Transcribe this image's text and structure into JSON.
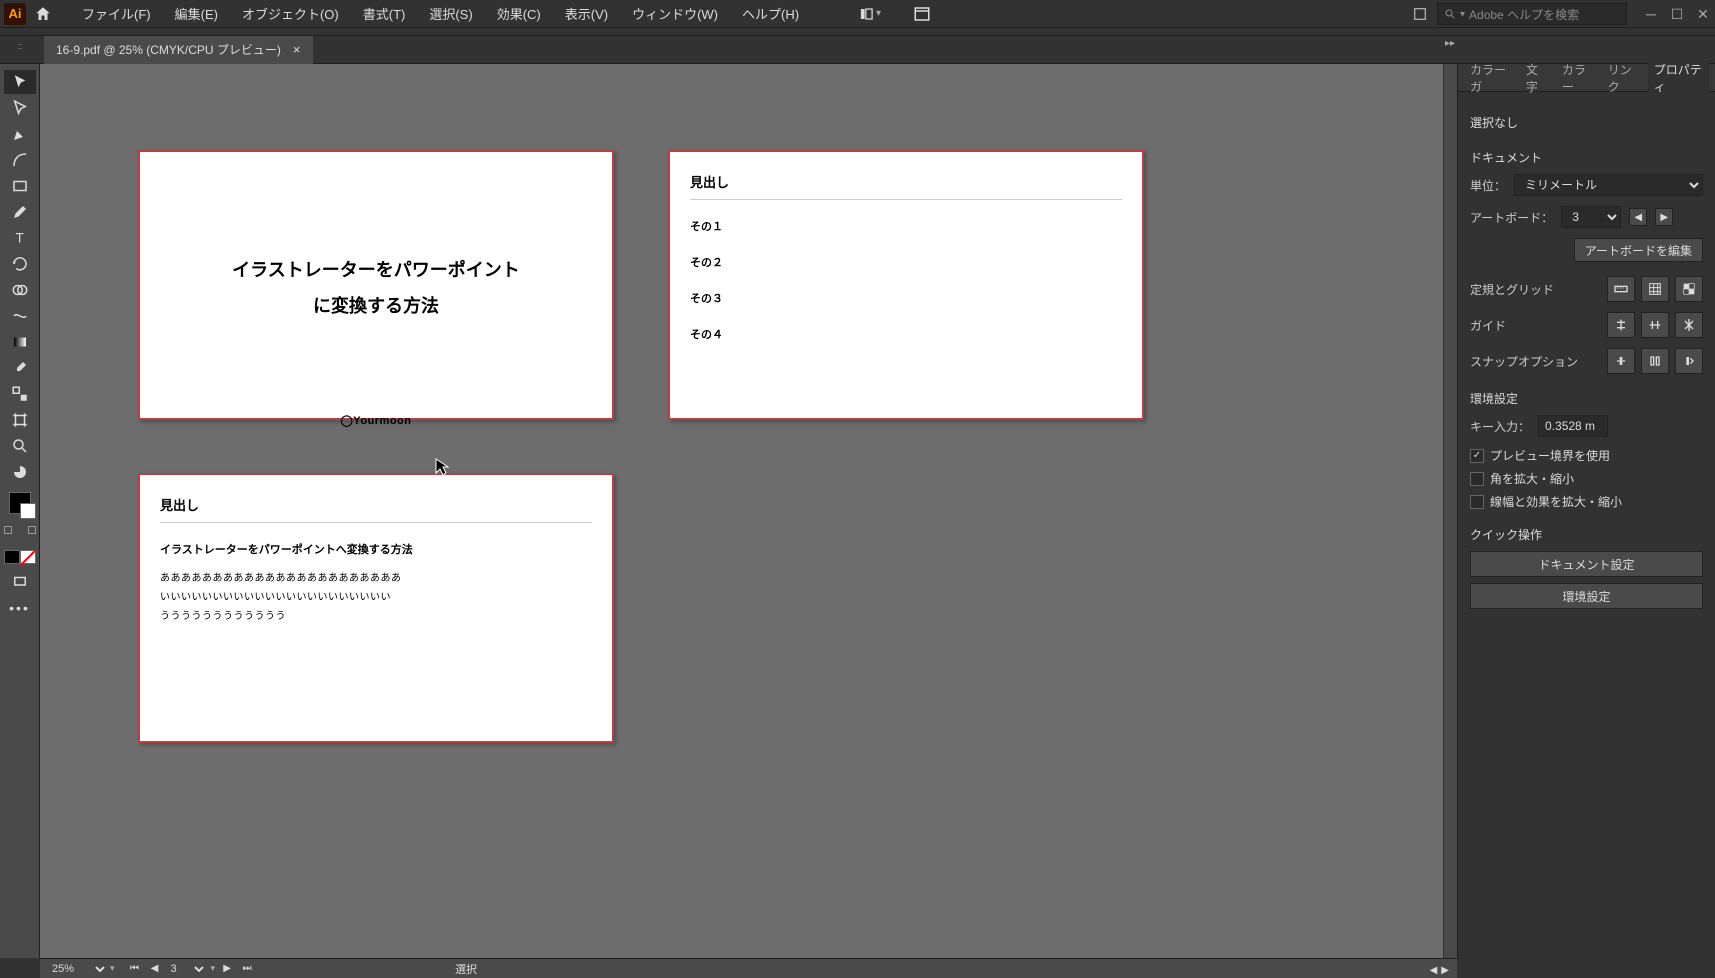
{
  "menu": {
    "items": [
      "ファイル(F)",
      "編集(E)",
      "オブジェクト(O)",
      "書式(T)",
      "選択(S)",
      "効果(C)",
      "表示(V)",
      "ウィンドウ(W)",
      "ヘルプ(H)"
    ]
  },
  "search": {
    "placeholder": "Adobe ヘルプを検索"
  },
  "tab": {
    "name": "16-9.pdf @ 25% (CMYK/CPU プレビュー)"
  },
  "artboards": {
    "ab1": {
      "line1": "イラストレーターをパワーポイント",
      "line2": "に変換する方法",
      "brand": "◯Yourmoon"
    },
    "ab2": {
      "heading": "見出し",
      "items": [
        "その１",
        "その２",
        "その３",
        "その４"
      ]
    },
    "ab3": {
      "heading": "見出し",
      "subtitle": "イラストレーターをパワーポイントへ変換する方法",
      "line1": "あああああああああああああああああああああああ",
      "line2": "いいいいいいいいいいいいいいいいいいいいいい",
      "line3": "うううううううううううう"
    }
  },
  "panel": {
    "tabs": [
      "カラーガ",
      "文字",
      "カラー",
      "リンク",
      "プロパティ"
    ],
    "selection": "選択なし",
    "doc_title": "ドキュメント",
    "units_label": "単位：",
    "units_value": "ミリメートル",
    "artboard_label": "アートボード：",
    "artboard_value": "3",
    "edit_artboard": "アートボードを編集",
    "ruler_grid": "定規とグリッド",
    "guide": "ガイド",
    "snap": "スナップオプション",
    "prefs_title": "環境設定",
    "key_input_label": "キー入力：",
    "key_input_value": "0.3528 m",
    "preview_bounds": "プレビュー境界を使用",
    "scale_corners": "角を拡大・縮小",
    "scale_strokes": "線幅と効果を拡大・縮小",
    "quick_ops": "クイック操作",
    "doc_setup": "ドキュメント設定",
    "prefs_btn": "環境設定"
  },
  "status": {
    "zoom": "25%",
    "page": "3",
    "mode": "選択"
  }
}
